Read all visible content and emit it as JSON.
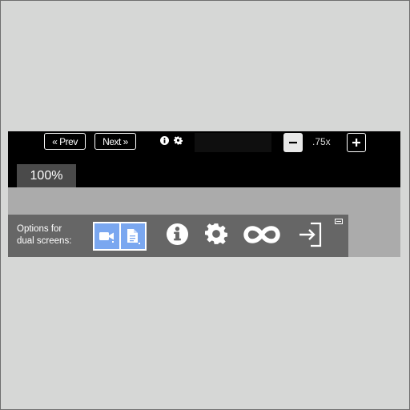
{
  "nav": {
    "prev_label": "« Prev",
    "next_label": "Next »"
  },
  "zoom": {
    "value": ".75x",
    "tab_label": "100%"
  },
  "options": {
    "label_line1": "Options for",
    "label_line2": "dual screens:",
    "active_color": "#7aa7f0"
  },
  "icons": [
    "info-icon",
    "gear-icon",
    "video-icon",
    "document-icon",
    "loop-icon",
    "exit-icon",
    "minimize-icon"
  ]
}
